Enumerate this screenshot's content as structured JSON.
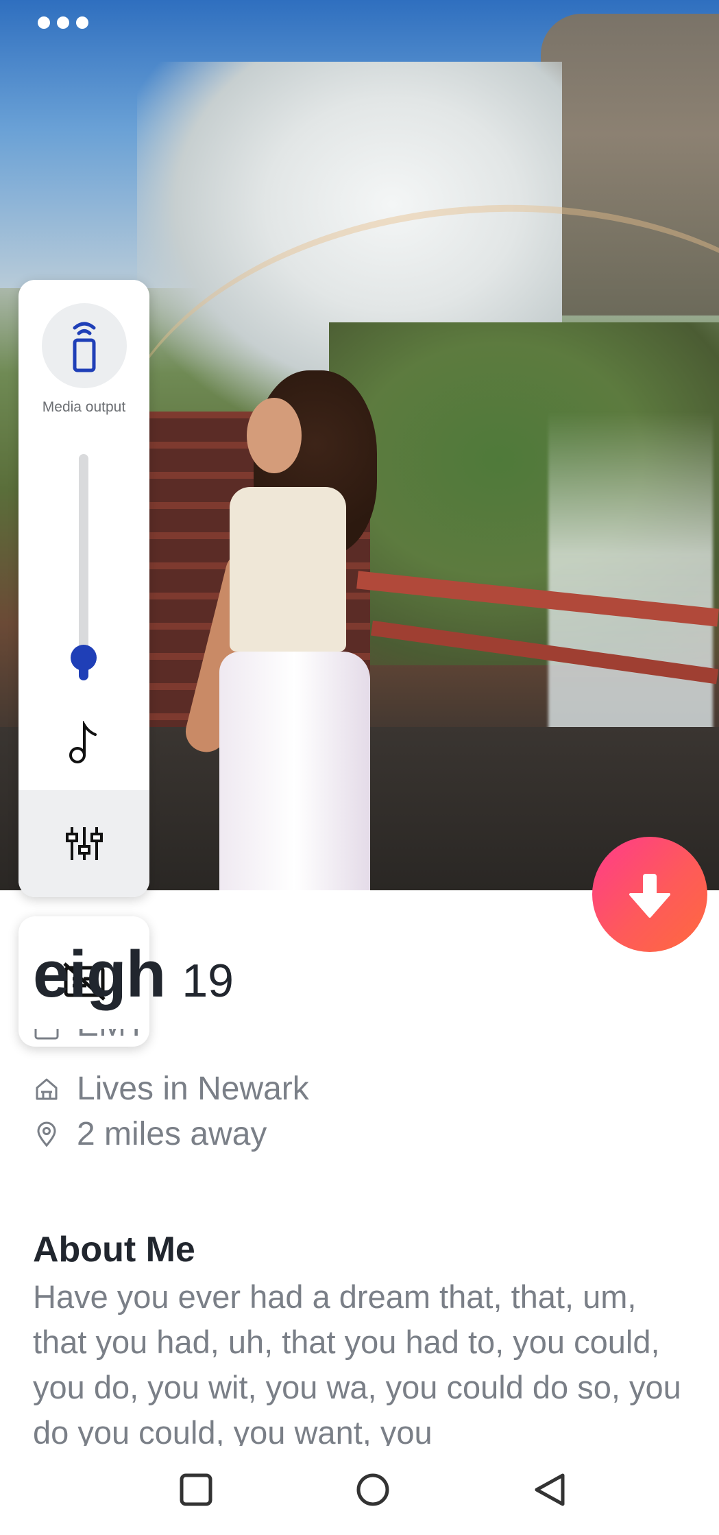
{
  "status": {
    "menu_icon": "three-dots-icon"
  },
  "volume_panel": {
    "media_output_label": "Media output",
    "media_output_icon": "speaker-cast-icon",
    "volume_level": 0.1,
    "music_icon": "music-note-icon",
    "equalizer_icon": "sliders-icon",
    "captions_icon": "captions-off-icon",
    "accent_color": "#1f3fb7"
  },
  "profile": {
    "name_visible": "eigh",
    "age": "19",
    "partial_line": "EMT",
    "partial_icon": "briefcase-icon",
    "lives_in": "Lives in Newark",
    "lives_icon": "home-icon",
    "distance": "2 miles away",
    "distance_icon": "location-pin-icon",
    "fab_icon": "arrow-down-icon",
    "fab_color": "#fe4f6b"
  },
  "about": {
    "title": "About Me",
    "body": "Have you ever had a dream that, that, um, that you had, uh, that you had to, you could, you do, you wit, you wa, you could do so, you do you could, you want, you"
  },
  "nav": {
    "recents_icon": "square-icon",
    "home_icon": "circle-icon",
    "back_icon": "triangle-back-icon"
  }
}
